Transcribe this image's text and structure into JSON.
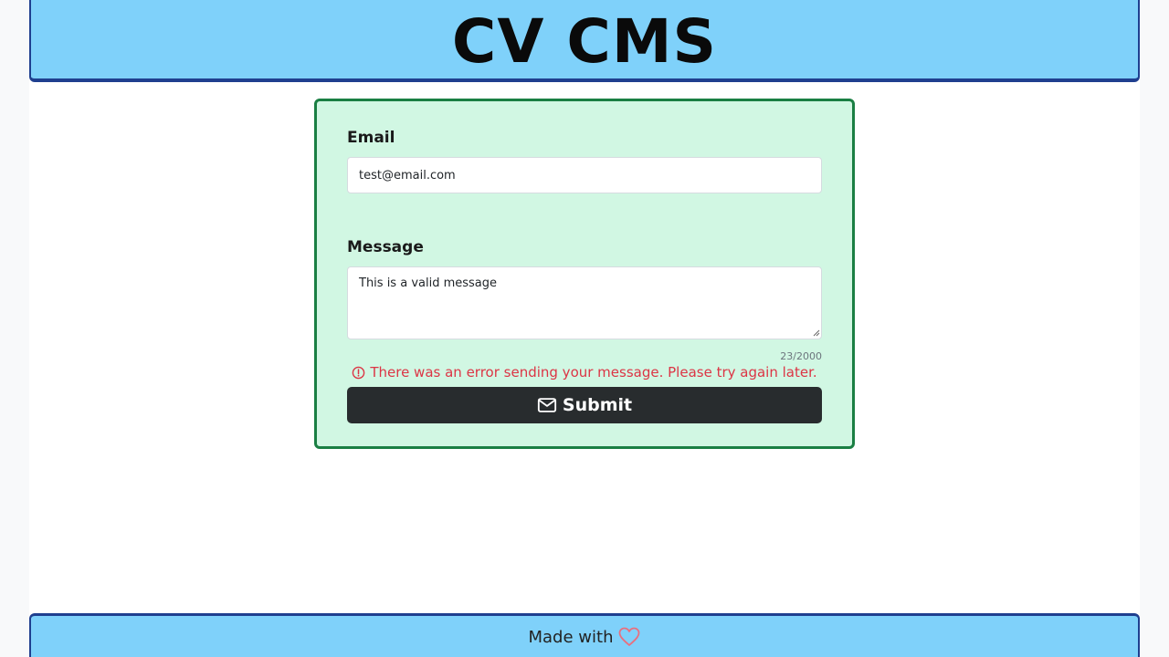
{
  "header": {
    "title": "CV CMS"
  },
  "form": {
    "email_label": "Email",
    "email_value": "test@email.com",
    "message_label": "Message",
    "message_value": "This is a valid message",
    "char_count": "23/2000",
    "error_text": "There was an error sending your message. Please try again later.",
    "error_icon": "alert-circle-icon",
    "submit_label": "Submit",
    "submit_icon": "mail-icon"
  },
  "footer": {
    "text": "Made with",
    "icon": "heart-icon"
  },
  "colors": {
    "header_bg": "#7fd1fa",
    "header_border": "#1f3f8f",
    "card_bg": "#d1f7e3",
    "card_border": "#1a7f43",
    "error": "#dc3545",
    "button_bg": "#282c2e",
    "heart": "#e8707f"
  }
}
